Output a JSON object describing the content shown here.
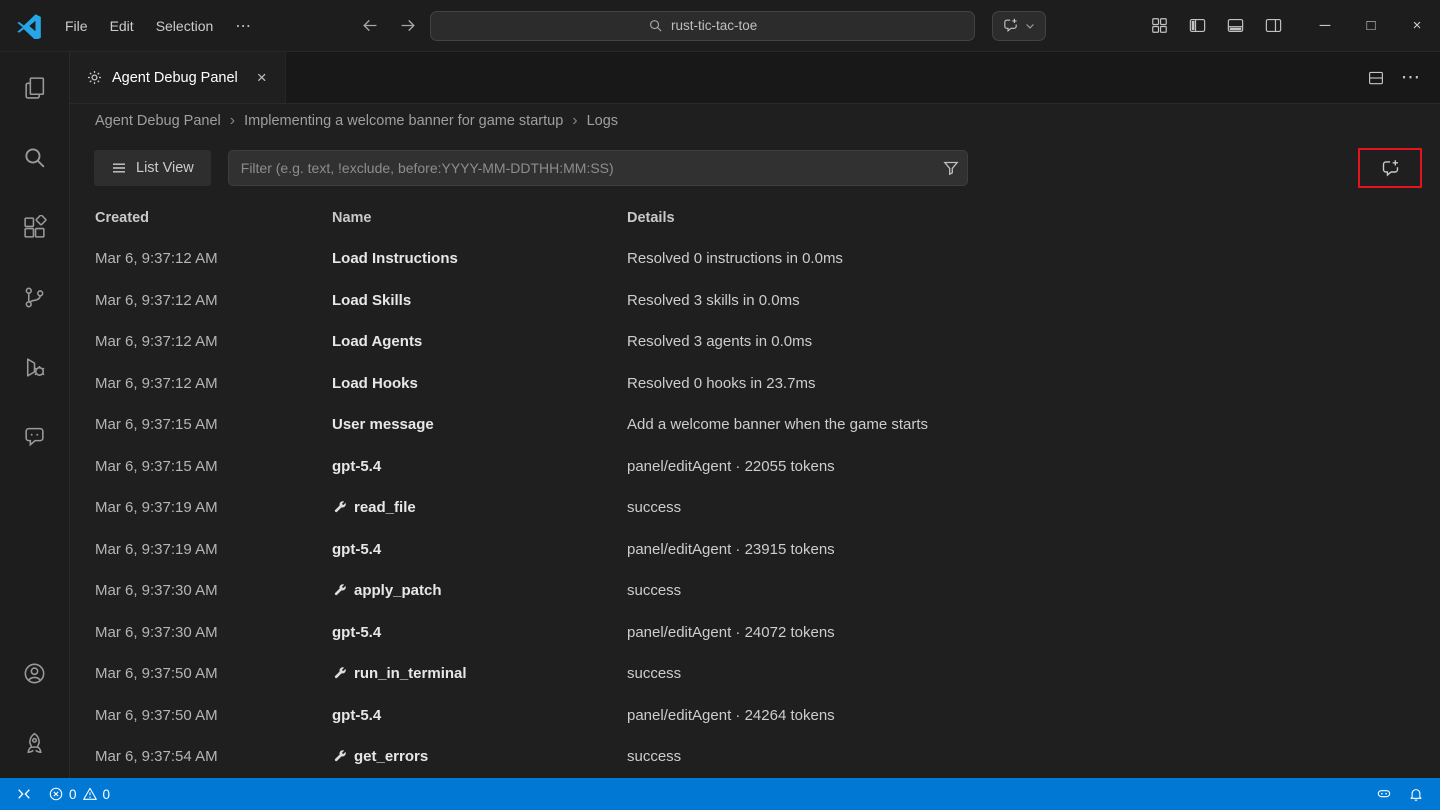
{
  "colors": {
    "accent_red": "#e6131e",
    "status_blue": "#0078d4",
    "logo_blue": "#26a6e6"
  },
  "titlebar": {
    "menus": [
      {
        "label": "File"
      },
      {
        "label": "Edit"
      },
      {
        "label": "Selection"
      }
    ],
    "more_label": "⋯",
    "search_value": "rust-tic-tac-toe",
    "window_controls": {
      "minimize": "─",
      "maximize": "□",
      "close": "×"
    }
  },
  "editor_tab": {
    "label": "Agent Debug Panel",
    "close_label": "×"
  },
  "tabbar_actions": {
    "more_label": "⋯"
  },
  "breadcrumb": {
    "separator": "›",
    "items": [
      {
        "label": "Agent Debug Panel"
      },
      {
        "label": "Implementing a welcome banner for game startup"
      },
      {
        "label": "Logs"
      }
    ]
  },
  "toolbar": {
    "view_button_label": "List View",
    "filter_placeholder": "Filter (e.g. text, !exclude, before:YYYY-MM-DDTHH:MM:SS)"
  },
  "table": {
    "columns": [
      {
        "label": "Created"
      },
      {
        "label": "Name"
      },
      {
        "label": "Details"
      }
    ],
    "rows": [
      {
        "created": "Mar 6, 9:37:12 AM",
        "name": "Load Instructions",
        "tool": false,
        "details": "Resolved 0 instructions in 0.0ms"
      },
      {
        "created": "Mar 6, 9:37:12 AM",
        "name": "Load Skills",
        "tool": false,
        "details": "Resolved 3 skills in 0.0ms"
      },
      {
        "created": "Mar 6, 9:37:12 AM",
        "name": "Load Agents",
        "tool": false,
        "details": "Resolved 3 agents in 0.0ms"
      },
      {
        "created": "Mar 6, 9:37:12 AM",
        "name": "Load Hooks",
        "tool": false,
        "details": "Resolved 0 hooks in 23.7ms"
      },
      {
        "created": "Mar 6, 9:37:15 AM",
        "name": "User message",
        "tool": false,
        "details": "Add a welcome banner when the game starts"
      },
      {
        "created": "Mar 6, 9:37:15 AM",
        "name": "gpt-5.4",
        "tool": false,
        "details": "panel/editAgent · 22055 tokens"
      },
      {
        "created": "Mar 6, 9:37:19 AM",
        "name": "read_file",
        "tool": true,
        "details": "success"
      },
      {
        "created": "Mar 6, 9:37:19 AM",
        "name": "gpt-5.4",
        "tool": false,
        "details": "panel/editAgent · 23915 tokens"
      },
      {
        "created": "Mar 6, 9:37:30 AM",
        "name": "apply_patch",
        "tool": true,
        "details": "success"
      },
      {
        "created": "Mar 6, 9:37:30 AM",
        "name": "gpt-5.4",
        "tool": false,
        "details": "panel/editAgent · 24072 tokens"
      },
      {
        "created": "Mar 6, 9:37:50 AM",
        "name": "run_in_terminal",
        "tool": true,
        "details": "success"
      },
      {
        "created": "Mar 6, 9:37:50 AM",
        "name": "gpt-5.4",
        "tool": false,
        "details": "panel/editAgent · 24264 tokens"
      },
      {
        "created": "Mar 6, 9:37:54 AM",
        "name": "get_errors",
        "tool": true,
        "details": "success"
      }
    ]
  },
  "statusbar": {
    "error_count": "0",
    "warning_count": "0"
  }
}
